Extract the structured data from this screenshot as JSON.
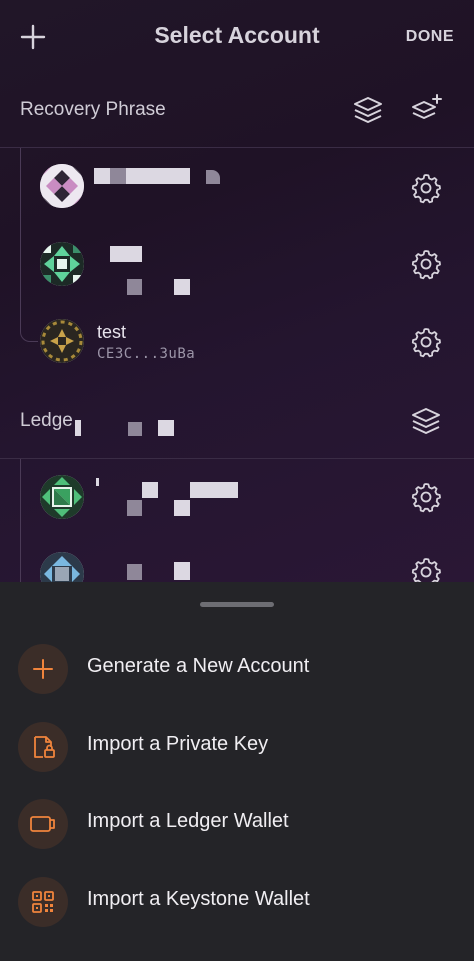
{
  "header": {
    "title": "Select Account",
    "done_label": "DONE"
  },
  "sections": [
    {
      "title": "Recovery Phrase",
      "accounts": [
        {
          "name": "",
          "address": ""
        },
        {
          "name": "",
          "address": ""
        },
        {
          "name": "test",
          "address": "CE3C...3uBa"
        }
      ]
    },
    {
      "title": "Ledge",
      "accounts": [
        {
          "name": "",
          "address": ""
        },
        {
          "name": "",
          "address": ""
        }
      ]
    }
  ],
  "sheet": {
    "items": [
      {
        "label": "Generate a New Account",
        "icon": "plus-icon"
      },
      {
        "label": "Import a Private Key",
        "icon": "key-file-icon"
      },
      {
        "label": "Import a Ledger Wallet",
        "icon": "ledger-icon"
      },
      {
        "label": "Import a Keystone Wallet",
        "icon": "qr-code-icon"
      }
    ]
  },
  "colors": {
    "accent": "#f0843c",
    "sheet_background": "#242428",
    "screen_background": "#211628"
  }
}
